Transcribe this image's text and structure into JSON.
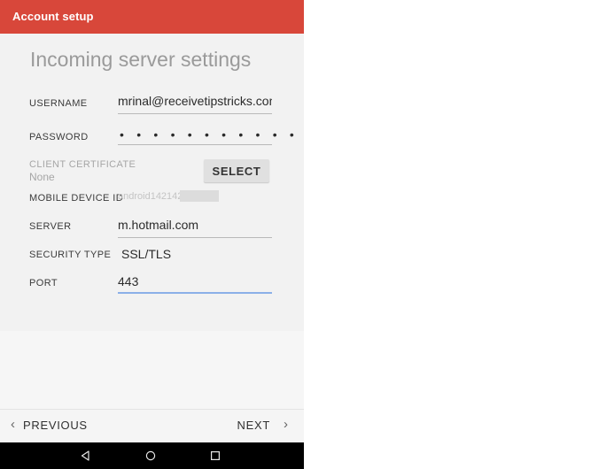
{
  "appbar": {
    "title": "Account setup",
    "color": "#d8473a"
  },
  "page": {
    "title": "Incoming server settings"
  },
  "form": {
    "username": {
      "label": "USERNAME",
      "value": "mrinal@receivetipstricks.com"
    },
    "password": {
      "label": "PASSWORD",
      "value": "• • • • • • • • • • • • • • •"
    },
    "client_certificate": {
      "label": "CLIENT CERTIFICATE",
      "value": "None",
      "button_label": "SELECT"
    },
    "mobile_device_id": {
      "label": "MOBILE DEVICE ID",
      "value": "android142142"
    },
    "server": {
      "label": "SERVER",
      "value": "m.hotmail.com"
    },
    "security_type": {
      "label": "SECURITY TYPE",
      "value": "SSL/TLS"
    },
    "port": {
      "label": "PORT",
      "value": "443",
      "focus_color": "#8bb0e8"
    }
  },
  "bottom_bar": {
    "previous_label": "PREVIOUS",
    "previous_chevron": "‹",
    "next_label": "NEXT",
    "next_chevron": "›"
  },
  "system_nav": {
    "back": "back-triangle-icon",
    "home": "home-circle-icon",
    "recents": "recents-square-icon"
  }
}
